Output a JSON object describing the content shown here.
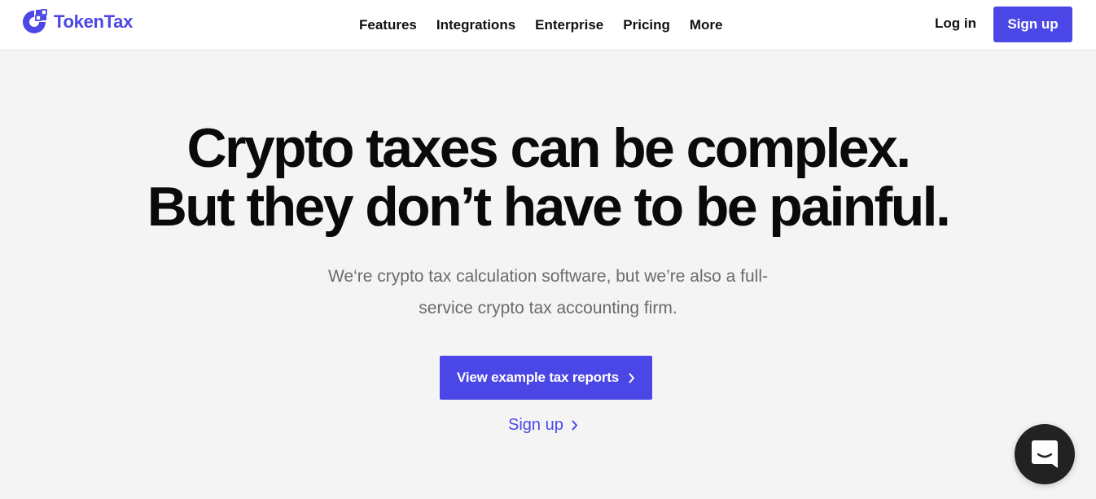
{
  "brand": {
    "name": "TokenTax",
    "icon": "tokentax-logo-icon",
    "color": "#4b47e6"
  },
  "nav": {
    "items": [
      {
        "label": "Features"
      },
      {
        "label": "Integrations"
      },
      {
        "label": "Enterprise"
      },
      {
        "label": "Pricing"
      },
      {
        "label": "More"
      }
    ],
    "login_label": "Log in",
    "signup_label": "Sign up"
  },
  "hero": {
    "title_line1": "Crypto taxes can be complex.",
    "title_line2": "But they don’t have to be painful.",
    "subtitle": "We‘re crypto tax calculation software, but we’re also a full-service crypto tax accounting firm.",
    "cta_label": "View example tax reports",
    "cta_icon": "chevron-right-icon",
    "secondary_label": "Sign up",
    "secondary_icon": "chevron-right-icon"
  },
  "chat_widget": {
    "icon": "chat-bubble-icon",
    "color": "#222222"
  }
}
